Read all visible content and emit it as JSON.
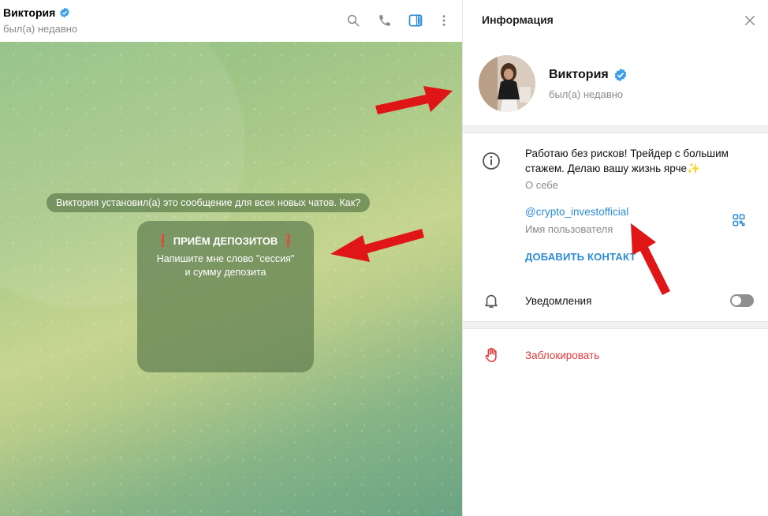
{
  "chat": {
    "header": {
      "name": "Виктория",
      "status": "был(а) недавно"
    },
    "service_message": "Виктория установил(а) это сообщение для всех новых чатов. Как?",
    "pinned_card": {
      "title": "ПРИЁМ ДЕПОЗИТОВ",
      "text_line1": "Напишите мне слово \"сессия\"",
      "text_line2": "и сумму депозита"
    }
  },
  "info_panel": {
    "title": "Информация",
    "profile": {
      "name": "Виктория",
      "status": "был(а) недавно"
    },
    "bio": {
      "text": "Работаю без рисков! Трейдер с большим стажем. Делаю вашу жизнь ярче✨",
      "label": "О себе"
    },
    "username": {
      "value": "@crypto_investofficial",
      "label": "Имя пользователя"
    },
    "add_contact_label": "ДОБАВИТЬ КОНТАКТ",
    "notifications_label": "Уведомления",
    "notifications_on": false,
    "block_label": "Заблокировать"
  },
  "colors": {
    "accent": "#2a8bd6",
    "danger": "#dc3b3b",
    "verified": "#3a9ee8",
    "annotation_arrow": "#e01515"
  },
  "icons": [
    "verified-badge-icon",
    "search-icon",
    "phone-icon",
    "sidebar-toggle-icon",
    "more-vertical-icon",
    "close-icon",
    "info-icon",
    "qr-code-icon",
    "bell-icon",
    "stop-hand-icon"
  ]
}
